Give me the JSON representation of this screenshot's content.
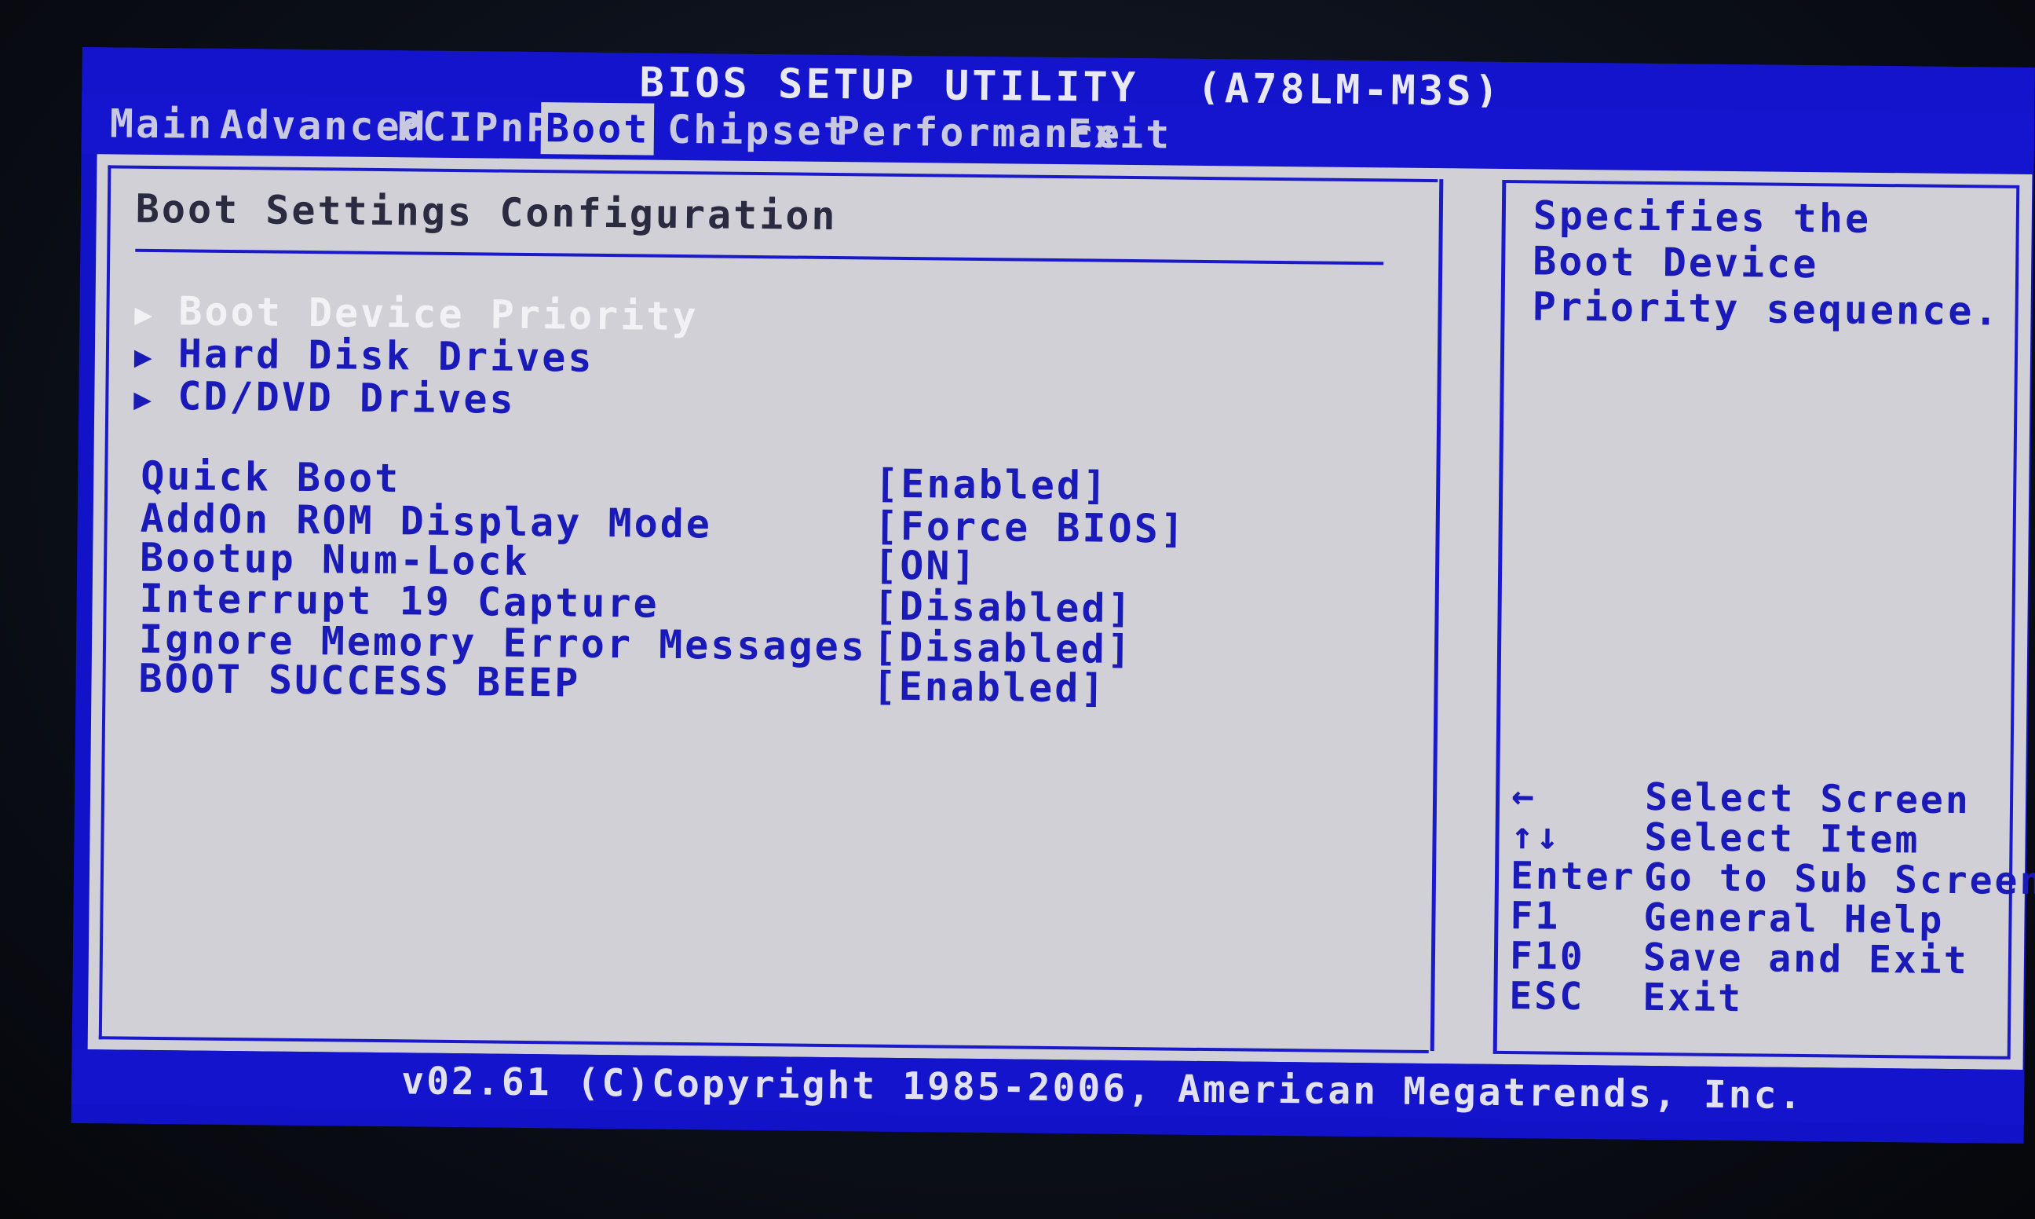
{
  "header": {
    "title": "BIOS SETUP UTILITY",
    "model": "(A78LM-M3S)"
  },
  "menu": {
    "items": [
      {
        "label": "Main"
      },
      {
        "label": "Advanced"
      },
      {
        "label": "PCIPnP"
      },
      {
        "label": "Boot"
      },
      {
        "label": "Chipset"
      },
      {
        "label": "Performance"
      },
      {
        "label": "Exit"
      }
    ],
    "active": "Boot"
  },
  "section": {
    "title": "Boot Settings Configuration"
  },
  "submenus": [
    {
      "label": "Boot Device Priority",
      "selected": true
    },
    {
      "label": "Hard Disk Drives",
      "selected": false
    },
    {
      "label": "CD/DVD Drives",
      "selected": false
    }
  ],
  "submenu_arrow": "▶",
  "settings": [
    {
      "label": "Quick Boot",
      "value": "[Enabled]"
    },
    {
      "label": "AddOn ROM Display Mode",
      "value": "[Force BIOS]"
    },
    {
      "label": "Bootup Num-Lock",
      "value": "[ON]"
    },
    {
      "label": "Interrupt 19 Capture",
      "value": "[Disabled]"
    },
    {
      "label": "Ignore Memory Error Messages",
      "value": "[Disabled]"
    },
    {
      "label": "BOOT SUCCESS BEEP",
      "value": "[Enabled]"
    }
  ],
  "help": {
    "lines": [
      "Specifies the",
      "Boot Device",
      "Priority sequence."
    ]
  },
  "keys": [
    {
      "key": "←",
      "desc": "Select Screen"
    },
    {
      "key": "↑↓",
      "desc": "Select Item"
    },
    {
      "key": "Enter",
      "desc": "Go to Sub Screen"
    },
    {
      "key": "F1",
      "desc": "General Help"
    },
    {
      "key": "F10",
      "desc": "Save and Exit"
    },
    {
      "key": "ESC",
      "desc": "Exit"
    }
  ],
  "footer": {
    "text": "v02.61 (C)Copyright 1985-2006, American Megatrends, Inc."
  },
  "colors": {
    "bios_blue": "#1414cc",
    "panel_gray": "#d0d0d6",
    "text_blue": "#1a1ab8",
    "highlight_white": "#f2f2f6"
  }
}
